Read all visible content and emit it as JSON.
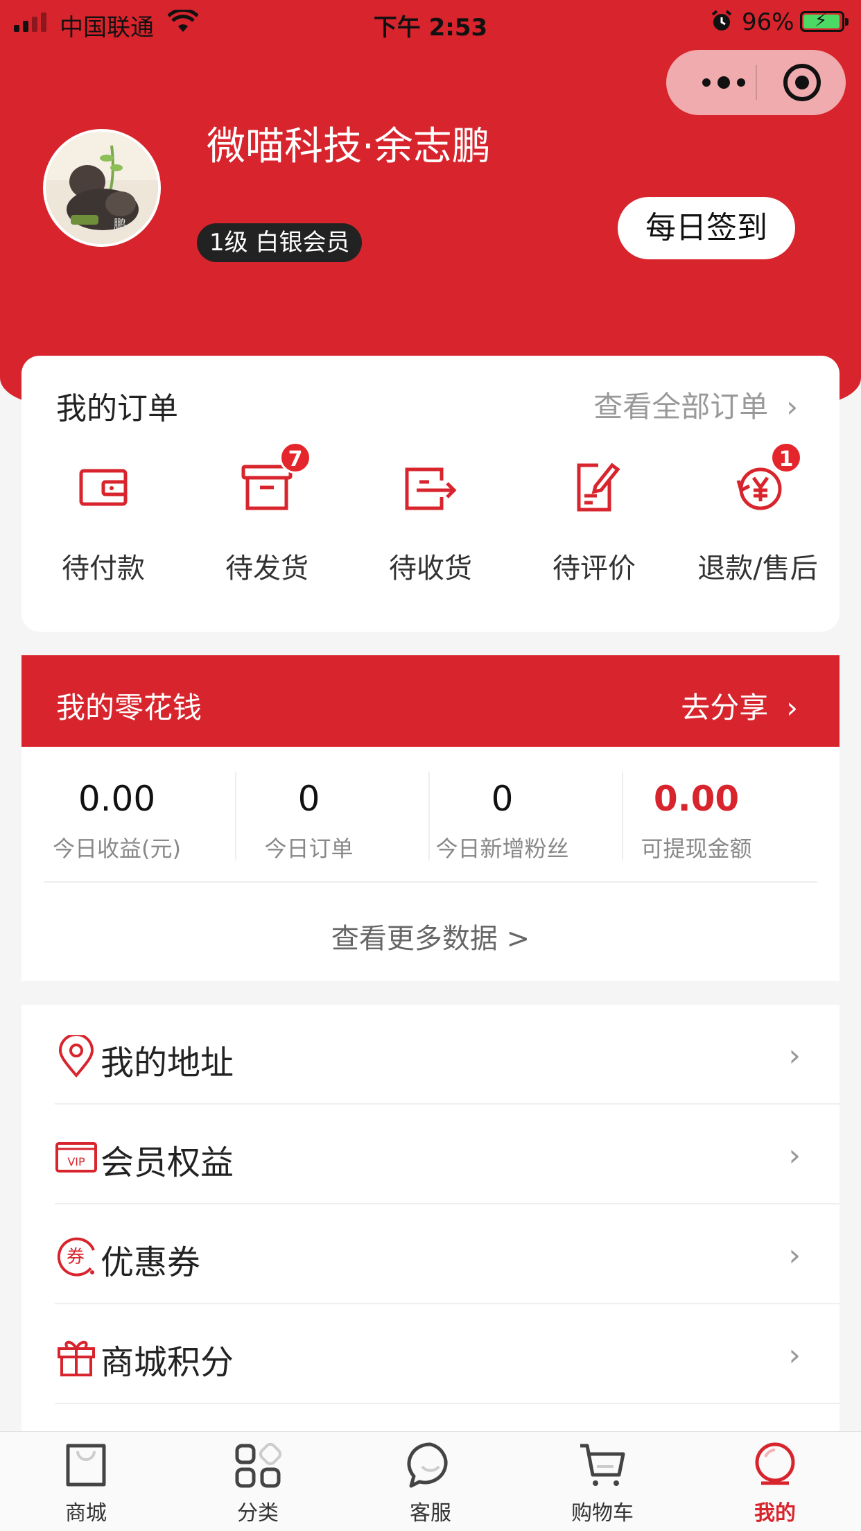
{
  "status_bar": {
    "carrier": "中国联通",
    "time": "下午 2:53",
    "battery": "96%"
  },
  "profile": {
    "name": "微喵科技·余志鹏",
    "level": "1级 白银会员",
    "signin_label": "每日签到"
  },
  "orders": {
    "title": "我的订单",
    "view_all": "查看全部订单",
    "items": [
      {
        "label": "待付款",
        "icon": "wallet-icon",
        "badge": ""
      },
      {
        "label": "待发货",
        "icon": "box-icon",
        "badge": "7"
      },
      {
        "label": "待收货",
        "icon": "delivery-icon",
        "badge": ""
      },
      {
        "label": "待评价",
        "icon": "review-icon",
        "badge": ""
      },
      {
        "label": "退款/售后",
        "icon": "refund-icon",
        "badge": "1"
      }
    ]
  },
  "money": {
    "title": "我的零花钱",
    "share": "去分享",
    "stats": [
      {
        "value": "0.00",
        "label": "今日收益(元)"
      },
      {
        "value": "0",
        "label": "今日订单"
      },
      {
        "value": "0",
        "label": "今日新增粉丝"
      },
      {
        "value": "0.00",
        "label": "可提现金额"
      }
    ],
    "more_data": "查看更多数据 >"
  },
  "menu": [
    {
      "label": "我的地址",
      "icon": "location-pin-icon"
    },
    {
      "label": "会员权益",
      "icon": "vip-card-icon"
    },
    {
      "label": "优惠券",
      "icon": "coupon-icon"
    },
    {
      "label": "商城积分",
      "icon": "gift-icon"
    }
  ],
  "tabs": [
    {
      "label": "商城",
      "icon": "shopping-bag-icon"
    },
    {
      "label": "分类",
      "icon": "category-grid-icon"
    },
    {
      "label": "客服",
      "icon": "chat-bubble-icon"
    },
    {
      "label": "购物车",
      "icon": "cart-icon"
    },
    {
      "label": "我的",
      "icon": "profile-icon",
      "active": true
    }
  ],
  "colors": {
    "brand": "#d8242c",
    "background": "#f5f5f5"
  }
}
